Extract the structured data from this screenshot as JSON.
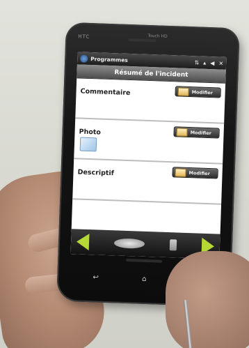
{
  "device": {
    "brand": "HTC",
    "model": "Touch HD"
  },
  "status_bar": {
    "app_title": "Programmes",
    "icons": [
      "start-icon",
      "network-icon",
      "signal-icon",
      "volume-icon",
      "close-icon"
    ],
    "close_glyph": "✕"
  },
  "screen": {
    "header": "Résumé de l'incident",
    "sections": [
      {
        "label": "Commentaire",
        "button": "Modifier"
      },
      {
        "label": "Photo",
        "button": "Modifier"
      },
      {
        "label": "Descriptif",
        "button": "Modifier"
      }
    ]
  },
  "nav": {
    "back_icon": "arrow-left-icon",
    "forward_icon": "arrow-right-icon",
    "accent_color": "#b6d835"
  },
  "hardware_keys": [
    "↩",
    "⌂",
    "↩"
  ]
}
